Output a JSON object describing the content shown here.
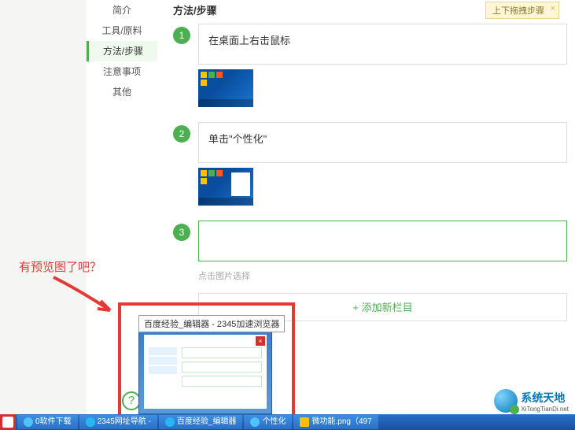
{
  "sidebar": {
    "items": [
      {
        "label": "简介"
      },
      {
        "label": "工具/原料"
      },
      {
        "label": "方法/步骤"
      },
      {
        "label": "注意事项"
      },
      {
        "label": "其他"
      }
    ],
    "active_index": 2
  },
  "main": {
    "title": "方法/步骤",
    "tooltip": {
      "text": "上下拖拽步骤",
      "close": "×"
    },
    "steps": [
      {
        "num": "1",
        "text": "在桌面上右击鼠标"
      },
      {
        "num": "2",
        "text": "单击\"个性化\""
      },
      {
        "num": "3",
        "text": ""
      }
    ],
    "upload_hint": "点击图片选择",
    "add_section": "添加新栏目"
  },
  "annotation": "有预览图了吧？",
  "preview": {
    "tooltip": "百度经验_编辑器 - 2345加速浏览器",
    "close": "×"
  },
  "help_icon": "?",
  "taskbar": {
    "items": [
      {
        "label": "0软件下载"
      },
      {
        "label": "2345网址导航 -"
      },
      {
        "label": "百度经验_编辑器"
      },
      {
        "label": "个性化"
      },
      {
        "label": "微功能.png（497"
      }
    ]
  },
  "watermark": {
    "title": "系统天地",
    "sub": "XiTongTianDi.net"
  }
}
